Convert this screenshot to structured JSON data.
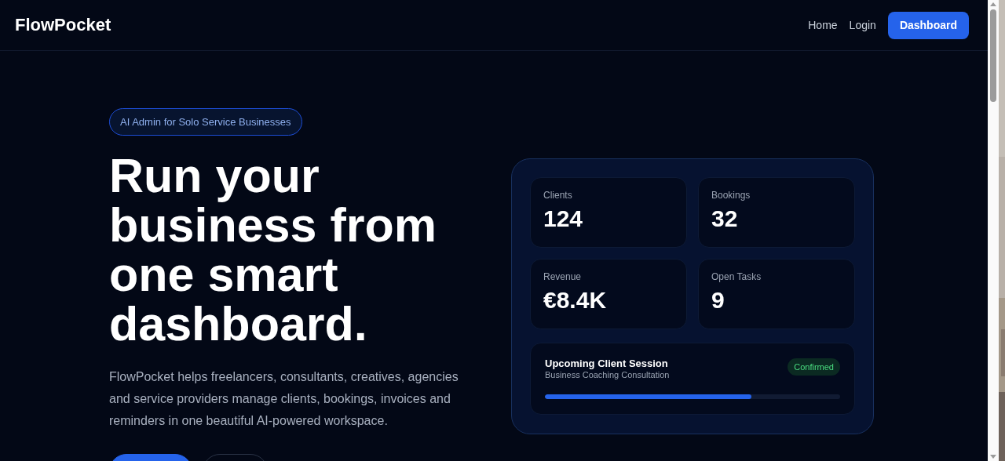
{
  "nav": {
    "logo": "FlowPocket",
    "links": [
      "Home",
      "Login"
    ],
    "cta": "Dashboard"
  },
  "hero": {
    "badge": "AI Admin for Solo Service Businesses",
    "headline": [
      "Run your",
      "business from",
      "one smart",
      "dashboard."
    ],
    "description": "FlowPocket helps freelancers, consultants, creatives, agencies and service providers manage clients, bookings, invoices and reminders in one beautiful AI-powered workspace.",
    "buttons": [
      {
        "kind": "primary"
      },
      {
        "kind": "outline"
      }
    ]
  },
  "preview": {
    "stats": [
      {
        "label": "Clients",
        "value": "124"
      },
      {
        "label": "Bookings",
        "value": "32"
      },
      {
        "label": "Revenue",
        "value": "€8.4K"
      },
      {
        "label": "Open Tasks",
        "value": "9"
      }
    ],
    "session": {
      "title": "Upcoming Client Session",
      "subtitle": "Business Coaching Consultation",
      "status": "Confirmed",
      "level": 0.7
    }
  }
}
